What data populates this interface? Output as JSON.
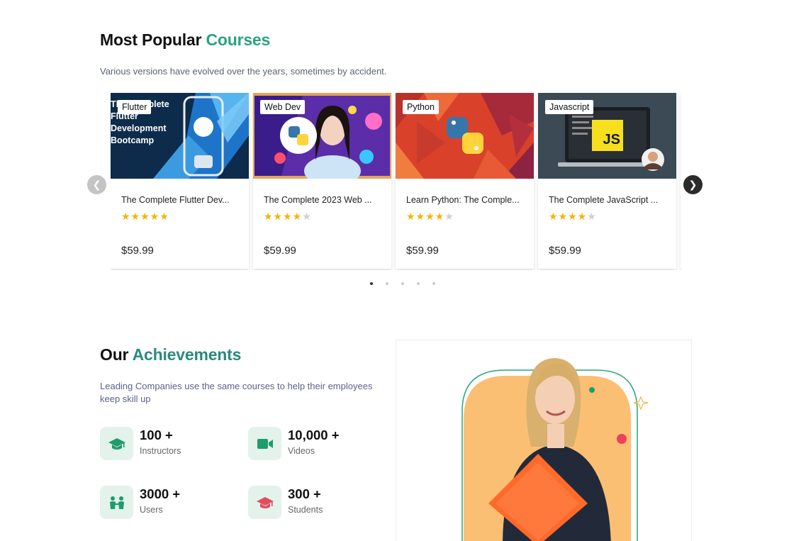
{
  "courses_section": {
    "title_plain": "Most Popular",
    "title_accent": "Courses",
    "subtitle": "Various versions have evolved over the years, sometimes by accident."
  },
  "courses": [
    {
      "tag": "Flutter",
      "thumb_text": "The Complete Flutter Development Bootcamp",
      "title": "The Complete Flutter Dev...",
      "rating": 5,
      "stars": "★★★★★",
      "stars_off": "",
      "price": "$59.99"
    },
    {
      "tag": "Web Dev",
      "title": "The Complete 2023 Web ...",
      "rating": 4,
      "stars": "★★★★",
      "stars_off": "★",
      "price": "$59.99"
    },
    {
      "tag": "Python",
      "title": "Learn Python: The Comple...",
      "rating": 4,
      "stars": "★★★★",
      "stars_off": "★",
      "price": "$59.99"
    },
    {
      "tag": "Javascript",
      "thumb_text": "JS",
      "title": "The Complete JavaScript ...",
      "rating": 4,
      "stars": "★★★★",
      "stars_off": "★",
      "price": "$59.99"
    }
  ],
  "carousel": {
    "prev_icon": "chevron-left-icon",
    "next_icon": "chevron-right-icon",
    "page_count": 5,
    "active_page": 1
  },
  "achievements_section": {
    "title_plain": "Our",
    "title_accent": "Achievements",
    "subtitle": "Leading Companies use the same courses to help their employees keep skill up"
  },
  "achievements": [
    {
      "value": "100 +",
      "label": "Instructors",
      "icon": "graduation-cap-icon"
    },
    {
      "value": "10,000 +",
      "label": "Videos",
      "icon": "video-camera-icon"
    },
    {
      "value": "3000 +",
      "label": "Users",
      "icon": "users-icon"
    },
    {
      "value": "300 +",
      "label": "Students",
      "icon": "graduation-cap-icon"
    }
  ],
  "colors": {
    "accent_green": "#2aa57a",
    "accent_teal": "#2b8a7e",
    "star": "#f5b400",
    "icon_bg": "#e3f3ec",
    "icon_green": "#1f9c6b",
    "icon_red": "#e64b5d",
    "photo_blob": "#fbbf74"
  }
}
